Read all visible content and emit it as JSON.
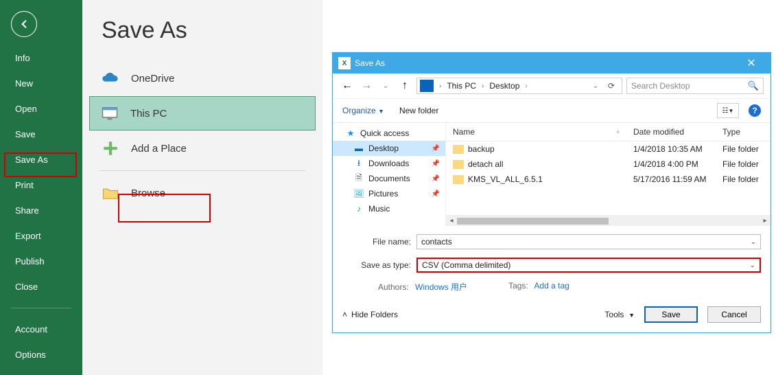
{
  "backstage": {
    "title": "Save As",
    "nav": {
      "info": "Info",
      "new": "New",
      "open": "Open",
      "save": "Save",
      "saveas": "Save As",
      "print": "Print",
      "share": "Share",
      "export": "Export",
      "publish": "Publish",
      "close": "Close",
      "account": "Account",
      "options": "Options"
    },
    "locations": {
      "onedrive": "OneDrive",
      "thispc": "This PC",
      "addplace": "Add a Place",
      "browse": "Browse"
    }
  },
  "dialog": {
    "title": "Save As",
    "breadcrumb": {
      "thispc": "This PC",
      "desktop": "Desktop"
    },
    "search_placeholder": "Search Desktop",
    "organize": "Organize",
    "newfolder": "New folder",
    "tree": {
      "quickaccess": "Quick access",
      "desktop": "Desktop",
      "downloads": "Downloads",
      "documents": "Documents",
      "pictures": "Pictures",
      "music": "Music"
    },
    "columns": {
      "name": "Name",
      "date": "Date modified",
      "type": "Type"
    },
    "files": [
      {
        "name": "backup",
        "date": "1/4/2018 10:35 AM",
        "type": "File folder"
      },
      {
        "name": "detach all",
        "date": "1/4/2018 4:00 PM",
        "type": "File folder"
      },
      {
        "name": "KMS_VL_ALL_6.5.1",
        "date": "5/17/2016 11:59 AM",
        "type": "File folder"
      }
    ],
    "filename": {
      "label": "File name:",
      "value": "contacts"
    },
    "saveastype": {
      "label": "Save as type:",
      "value": "CSV (Comma delimited)"
    },
    "authors": {
      "label": "Authors:",
      "value": "Windows 用户"
    },
    "tags": {
      "label": "Tags:",
      "value": "Add a tag"
    },
    "hidefolders": "Hide Folders",
    "tools": "Tools",
    "save": "Save",
    "cancel": "Cancel"
  }
}
